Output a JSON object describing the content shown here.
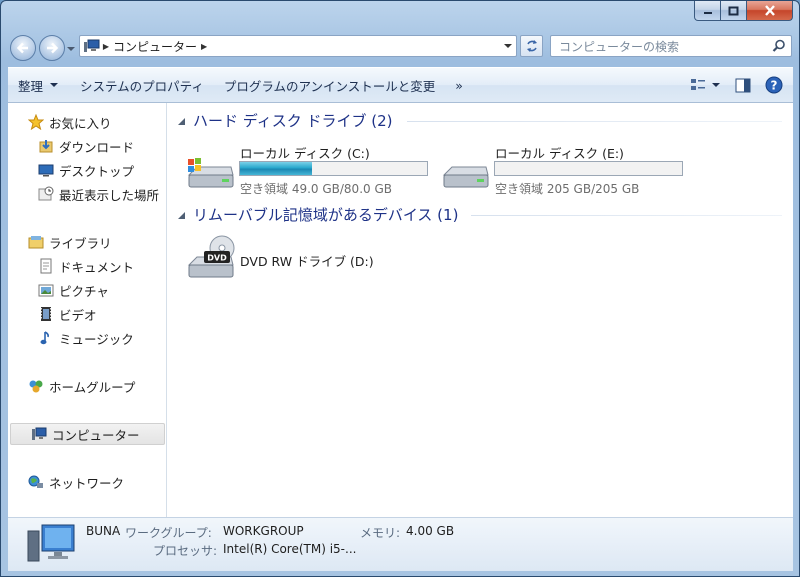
{
  "address": {
    "crumbs": [
      "コンピューター"
    ]
  },
  "search": {
    "placeholder": "コンピューターの検索"
  },
  "toolbar": {
    "organize": "整理",
    "system_properties": "システムのプロパティ",
    "uninstall": "プログラムのアンインストールと変更",
    "more": "»"
  },
  "sidebar": {
    "favorites": "お気に入り",
    "downloads": "ダウンロード",
    "desktop": "デスクトップ",
    "recent": "最近表示した場所",
    "libraries": "ライブラリ",
    "documents": "ドキュメント",
    "pictures": "ピクチャ",
    "videos": "ビデオ",
    "music": "ミュージック",
    "homegroup": "ホームグループ",
    "computer": "コンピューター",
    "network": "ネットワーク"
  },
  "groups": {
    "hdd_title": "ハード ディスク ドライブ (2)",
    "removable_title": "リムーバブル記憶域があるデバイス (1)"
  },
  "drives": [
    {
      "name": "ローカル ディスク (C:)",
      "free": "空き領域 49.0 GB/80.0 GB",
      "used_fraction": 0.3875
    },
    {
      "name": "ローカル ディスク (E:)",
      "free": "空き領域 205 GB/205 GB",
      "used_fraction": 0.0
    }
  ],
  "removable": {
    "name": "DVD RW ドライブ (D:)",
    "badge": "DVD"
  },
  "details": {
    "computer_name": "BUNA",
    "workgroup_label": "ワークグループ:",
    "workgroup_value": "WORKGROUP",
    "memory_label": "メモリ:",
    "memory_value": "4.00 GB",
    "processor_label": "プロセッサ:",
    "processor_value": "Intel(R) Core(TM) i5-..."
  },
  "colors": {
    "bar_fill": "#28a7cc",
    "group_heading": "#1e3287",
    "window_frame": "#a9c6e4"
  }
}
